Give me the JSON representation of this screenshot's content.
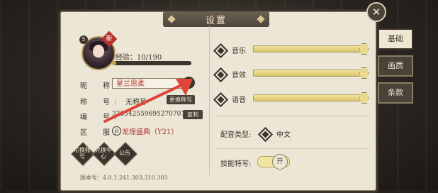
{
  "panel": {
    "title": "设置",
    "close_glyph": "✕"
  },
  "profile": {
    "level": "5",
    "new_badge": "新",
    "exp_label": "经验：",
    "exp_value": "10/190",
    "exp_progress": 0.05,
    "nickname_label": "昵　称:",
    "nickname": "星兰思柔",
    "title_label": "称　号:",
    "title_value": "无称号",
    "change_title_button": "更换称号",
    "id_label": "编　号:",
    "id_value": "33054255969527070​72",
    "copy_button": "复制",
    "server_label": "区　服:",
    "server_value": "龙煌盛典（Y21）",
    "actions": [
      "切换账号",
      "兑换中心",
      "公告"
    ],
    "version": "版本号：4.0.1.241.303.310.303"
  },
  "audio": {
    "music_label": "音乐",
    "music_level": 1.0,
    "sfx_label": "音效",
    "sfx_level": 1.0,
    "voice_label": "语音",
    "voice_level": 1.0
  },
  "voice_type": {
    "label": "配音类型:",
    "value": "中文"
  },
  "skill_effect": {
    "label": "技能特写:",
    "state": "开"
  },
  "tabs": [
    {
      "label": "基础",
      "active": true
    },
    {
      "label": "画质",
      "active": false
    },
    {
      "label": "条款",
      "active": false
    }
  ],
  "colors": {
    "accent_red": "#b0362e",
    "panel_bg": "#ece6d6",
    "dark": "#3b342c",
    "slider_fill": "#e9d98f"
  }
}
